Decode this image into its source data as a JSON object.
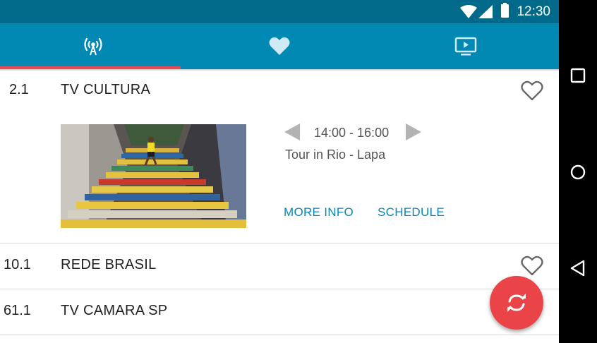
{
  "status_bar": {
    "time": "12:30"
  },
  "tabs": [
    {
      "name": "live",
      "icon": "antenna-icon"
    },
    {
      "name": "favorites",
      "icon": "heart-icon"
    },
    {
      "name": "recordings",
      "icon": "tv-play-icon"
    }
  ],
  "colors": {
    "status_bar": "#01698a",
    "tab_bar": "#0189b4",
    "tab_indicator": "#e84b4f",
    "action": "#0a87b5",
    "fab": "#ea4448"
  },
  "channels": [
    {
      "number": "2.1",
      "name": "TV CULTURA",
      "expanded": true,
      "program": {
        "time": "14:00 - 16:00",
        "title": "Tour in Rio - Lapa",
        "more_info_label": "MORE INFO",
        "schedule_label": "SCHEDULE"
      }
    },
    {
      "number": "10.1",
      "name": "REDE BRASIL"
    },
    {
      "number": "61.1",
      "name": "TV CAMARA SP"
    }
  ],
  "fab_icon": "refresh-icon",
  "nav": {
    "back": "back-icon",
    "home": "home-icon",
    "recents": "recents-icon"
  }
}
